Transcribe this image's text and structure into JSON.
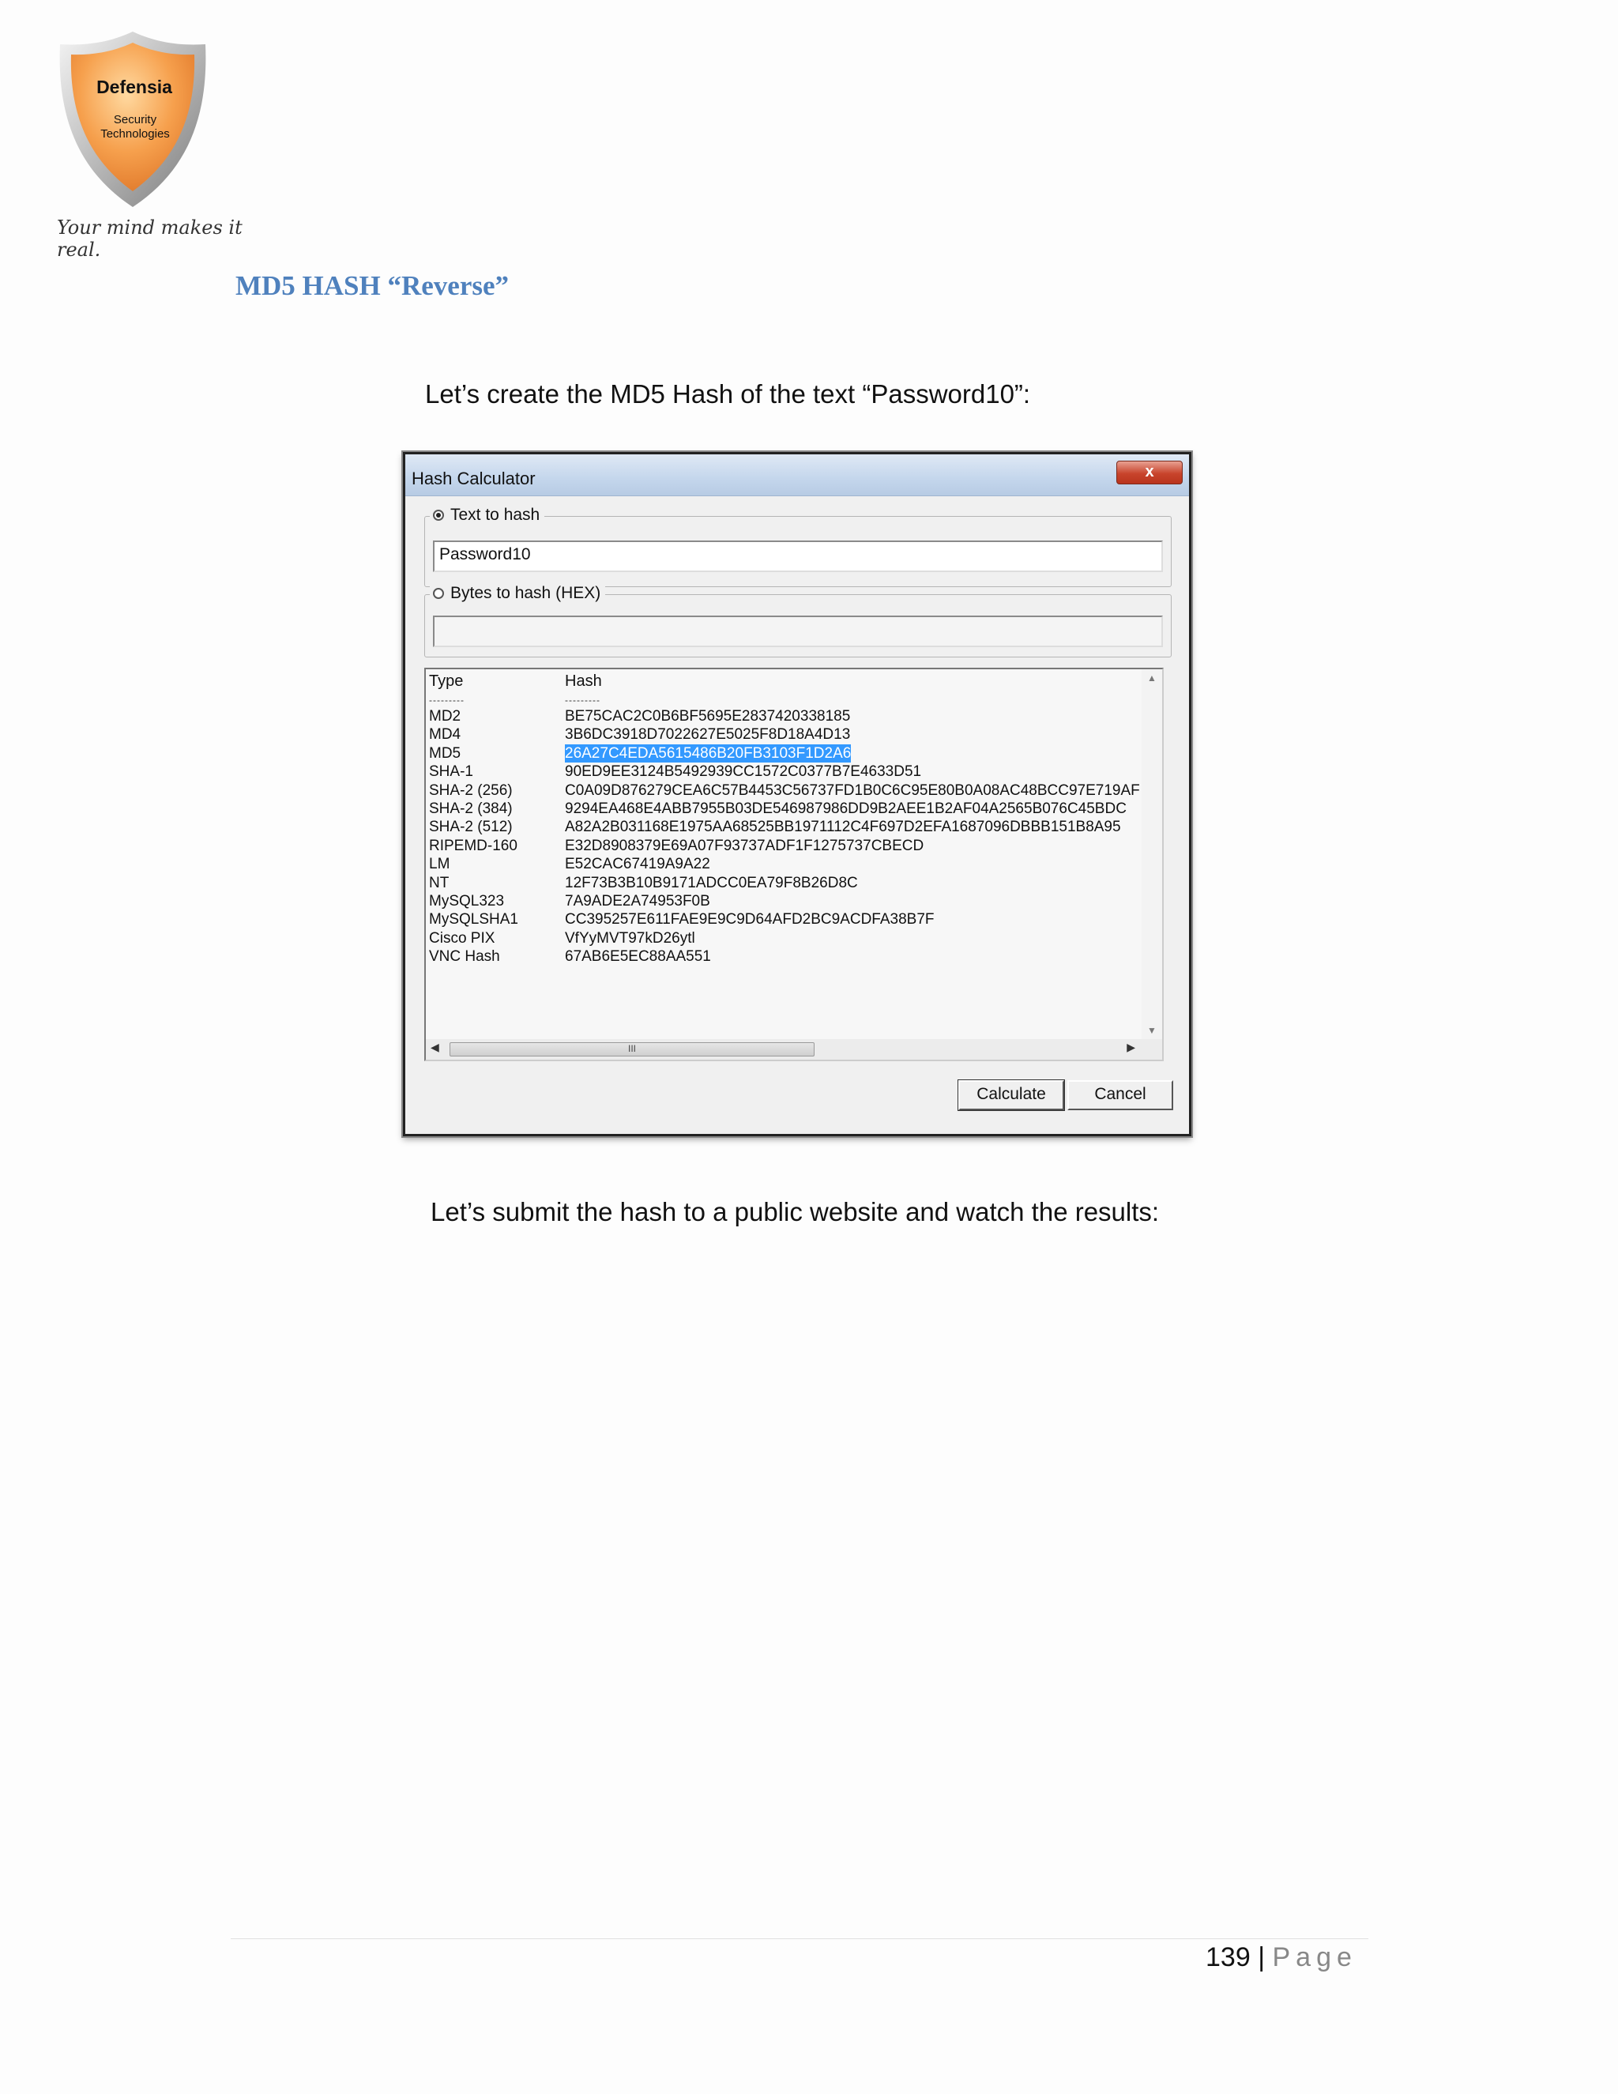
{
  "logo": {
    "name": "Defensia",
    "sub1": "Security",
    "sub2": "Technologies",
    "tagline": "Your mind makes it real."
  },
  "heading": "MD5 HASH “Reverse”",
  "para1": "Let’s create the MD5 Hash of the text “Password10”:",
  "para2": "Let’s submit the hash to a public website and watch the results:",
  "dialog": {
    "title": "Hash Calculator",
    "close_label": "x",
    "text_to_hash_label": "Text to hash",
    "text_value": "Password10",
    "bytes_to_hash_label": "Bytes to hash (HEX)",
    "bytes_value": "",
    "list": {
      "col_type": "Type",
      "col_hash": "Hash",
      "sep_type": "---------",
      "sep_hash": "---------",
      "rows": [
        {
          "type": "MD2",
          "hash": "BE75CAC2C0B6BF5695E2837420338185"
        },
        {
          "type": "MD4",
          "hash": "3B6DC3918D7022627E5025F8D18A4D13"
        },
        {
          "type": "MD5",
          "hash": "26A27C4EDA5615486B20FB3103F1D2A6"
        },
        {
          "type": "SHA-1",
          "hash": "90ED9EE3124B5492939CC1572C0377B7E4633D51"
        },
        {
          "type": "SHA-2 (256)",
          "hash": "C0A09D876279CEA6C57B4453C56737FD1B0C6C95E80B0A08AC48BCC97E719AF"
        },
        {
          "type": "SHA-2 (384)",
          "hash": "9294EA468E4ABB7955B03DE546987986DD9B2AEE1B2AF04A2565B076C45BDC"
        },
        {
          "type": "SHA-2 (512)",
          "hash": "A82A2B031168E1975AA68525BB1971112C4F697D2EFA1687096DBBB151B8A95"
        },
        {
          "type": "RIPEMD-160",
          "hash": "E32D8908379E69A07F93737ADF1F1275737CBECD"
        },
        {
          "type": "LM",
          "hash": "E52CAC67419A9A22"
        },
        {
          "type": "NT",
          "hash": "12F73B3B10B9171ADCC0EA79F8B26D8C"
        },
        {
          "type": "MySQL323",
          "hash": "7A9ADE2A74953F0B"
        },
        {
          "type": "MySQLSHA1",
          "hash": "CC395257E611FAE9E9C9D64AFD2BC9ACDFA38B7F"
        },
        {
          "type": "Cisco PIX",
          "hash": "VfYyMVT97kD26ytl"
        },
        {
          "type": "VNC Hash",
          "hash": "67AB6E5EC88AA551"
        }
      ]
    },
    "scroll_thumb_label": "III",
    "calculate_label": "Calculate",
    "cancel_label": "Cancel"
  },
  "footer": {
    "page_number": "139",
    "sep": "|",
    "page_word": "Page"
  },
  "colors": {
    "heading": "#4f81bd",
    "selection": "#3399ff",
    "logo_orange": "#f6a04d"
  }
}
